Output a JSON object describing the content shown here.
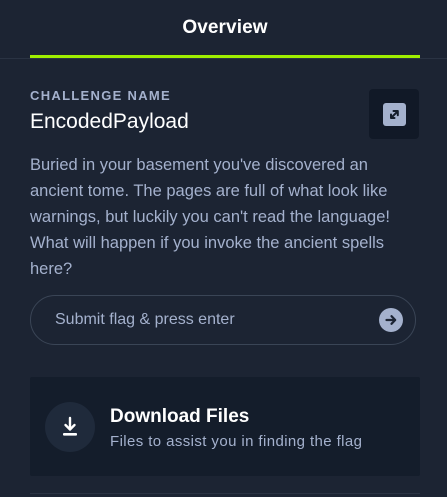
{
  "tabs": [
    {
      "label": "Overview",
      "active": true
    }
  ],
  "challenge": {
    "section_label": "CHALLENGE NAME",
    "name": "EncodedPayload",
    "description": "Buried in your basement you've discovered an ancient tome. The pages are full of what look like warnings, but luckily you can't read the language! What will happen if you invoke the ancient spells here?",
    "action_icon": "swap-arrows-icon"
  },
  "flag_form": {
    "placeholder": "Submit flag & press enter",
    "value": "",
    "submit_icon": "arrow-right-icon"
  },
  "download": {
    "title": "Download Files",
    "subtitle": "Files to assist you in finding the flag",
    "icon": "download-icon"
  },
  "colors": {
    "background": "#1c2433",
    "card": "#141d2b",
    "accent": "#9fef00",
    "muted_text": "#a4b1cd",
    "text": "#ffffff"
  }
}
